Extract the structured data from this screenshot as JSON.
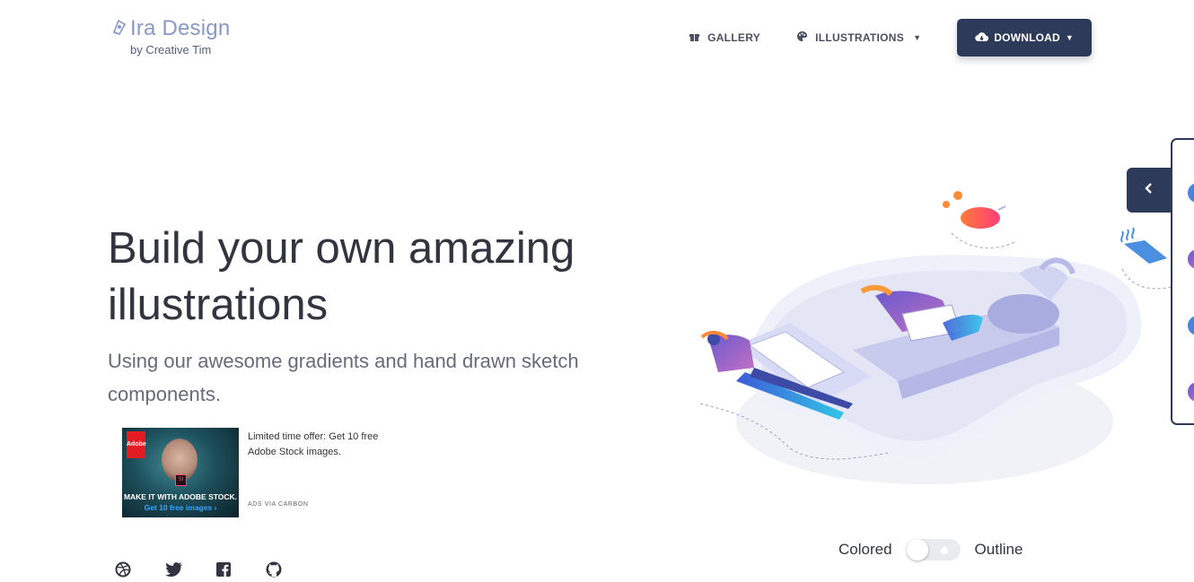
{
  "brand": {
    "title": "Ira Design",
    "subtitle": "by Creative Tim"
  },
  "nav": {
    "gallery": "GALLERY",
    "illustrations": "ILLUSTRATIONS",
    "download": "DOWNLOAD"
  },
  "hero": {
    "title_line1": "Build your own amazing",
    "title_line2": "illustrations",
    "subtitle": "Using our awesome gradients and hand drawn sketch components."
  },
  "ad": {
    "image_logo": "Adobe",
    "image_caption1": "MAKE IT WITH ADOBE STOCK.",
    "image_caption2": "Get 10 free images ›",
    "text": "Limited time offer: Get 10 free Adobe Stock images.",
    "via": "ADS VIA CARBON"
  },
  "toggle": {
    "left_label": "Colored",
    "right_label": "Outline",
    "state": "colored"
  },
  "icons": {
    "gallery": "gift-icon",
    "illustrations": "palette-icon",
    "download": "cloud-download-icon",
    "panel": "chevron-left-icon",
    "social": [
      "dribbble-icon",
      "twitter-icon",
      "facebook-icon",
      "github-icon"
    ]
  },
  "colors": {
    "brand": "#8898c8",
    "primary_dark": "#2e3a59",
    "heading": "#32353f",
    "body_text": "#666b7a"
  }
}
